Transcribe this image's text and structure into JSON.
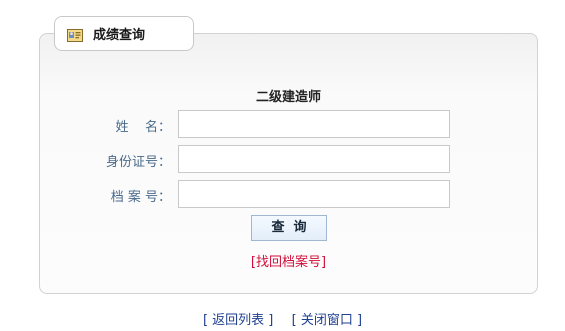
{
  "tab": {
    "icon": "id-card-icon",
    "title": "成绩查询"
  },
  "form": {
    "title": "二级建造师",
    "fields": [
      {
        "label": "姓    名：",
        "value": "",
        "placeholder": ""
      },
      {
        "label": "身份证号：",
        "value": "",
        "placeholder": ""
      },
      {
        "label": "档 案 号：",
        "value": "",
        "placeholder": ""
      }
    ],
    "query_button": "查  询",
    "find_link": "[找回档案号]"
  },
  "footer": {
    "back_link": "[ 返回列表 ]",
    "close_link": "[ 关闭窗口 ]"
  },
  "colors": {
    "label": "#4a6a8a",
    "find_link": "#d0103a",
    "footer_link": "#1f3f8f"
  }
}
